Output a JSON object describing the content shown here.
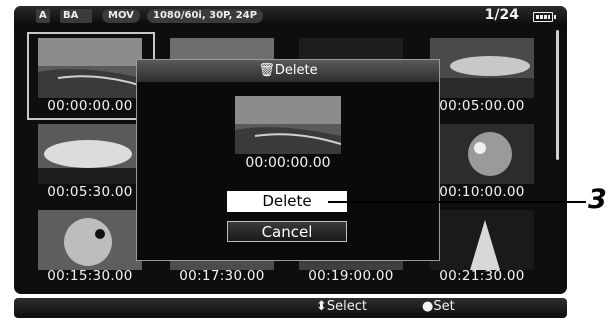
{
  "status": {
    "chip_a": "A",
    "chip_ba": "BA",
    "format": "MOV",
    "resolution": "1080/60i, 30P, 24P",
    "page": "1/24",
    "battery_icon": "battery-icon"
  },
  "grid": {
    "timecodes": [
      "00:00:00.00",
      "",
      "",
      "00:05:00.00",
      "00:05:30.00",
      "",
      "",
      "00:10:00.00",
      "00:15:30.00",
      "00:17:30.00",
      "00:19:00.00",
      "00:21:30.00"
    ]
  },
  "dialog": {
    "title": "Delete",
    "title_icon": "trash-icon",
    "timecode": "00:00:00.00",
    "delete_label": "Delete",
    "cancel_label": "Cancel"
  },
  "bottom": {
    "select_label": "Select",
    "select_icon": "up-down-icon",
    "set_label": "Set",
    "set_icon": "dot-icon"
  },
  "callout": {
    "number": "3"
  },
  "colors": {
    "screen_bg": "#0e0e0e",
    "selected_button": "#ffffff"
  }
}
